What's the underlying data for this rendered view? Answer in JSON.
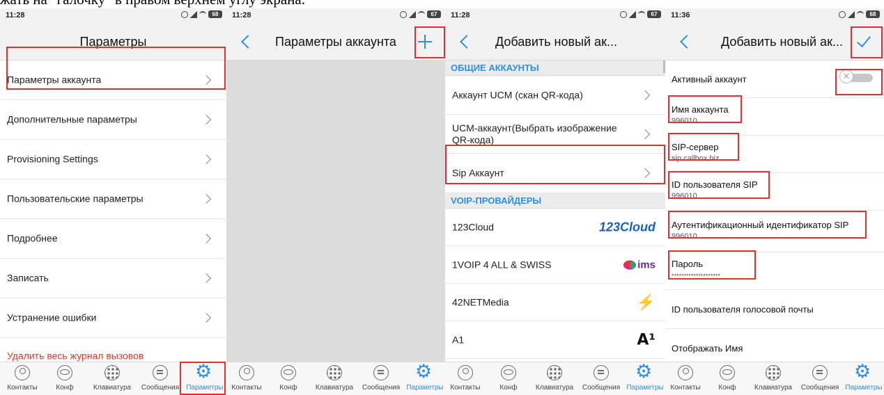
{
  "caption": "жать на \"галочку\" в правом верхнем углу экрана.",
  "status": {
    "s1": {
      "time": "11:28",
      "battery": "68"
    },
    "s2": {
      "time": "11:28",
      "battery": "67"
    },
    "s3": {
      "time": "11:28",
      "battery": "67"
    },
    "s4": {
      "time": "11:36",
      "battery": "68"
    }
  },
  "screen1": {
    "title": "Параметры",
    "items": [
      "Параметры аккаунта",
      "Дополнительные параметры",
      "Provisioning Settings",
      "Пользовательские параметры",
      "Подробнее",
      "Записать",
      "Устранение ошибки",
      "Удалить весь журнал вызовов"
    ]
  },
  "screen2": {
    "title": "Параметры аккаунта"
  },
  "screen3": {
    "title": "Добавить новый ак...",
    "section_general": "ОБЩИЕ АККАУНТЫ",
    "general_items": [
      "Аккаунт UCM (скан QR-кода)",
      "UCM-аккаунт(Выбрать изображение QR-кода)",
      "Sip Аккаунт"
    ],
    "section_voip": "VOIP-ПРОВАЙДЕРЫ",
    "providers": [
      {
        "name": "123Cloud",
        "logo": "123Cloud"
      },
      {
        "name": "1VOIP 4 ALL & SWISS",
        "logo": "ims"
      },
      {
        "name": "42NETMedia",
        "logo": "42-logo-icon"
      },
      {
        "name": "A1",
        "logo": "A1-logo-icon"
      }
    ]
  },
  "screen4": {
    "title": "Добавить новый ак...",
    "active_label": "Активный аккаунт",
    "fields": [
      {
        "label": "Имя аккаунта",
        "value": "996010"
      },
      {
        "label": "SIP-сервер",
        "value": "sip.callbox.biz"
      },
      {
        "label": "ID пользователя SIP",
        "value": "996010"
      },
      {
        "label": "Аутентификационный идентификатор SIP",
        "value": "996010"
      },
      {
        "label": "Пароль",
        "value": "********************"
      }
    ],
    "voicemail_label": "ID пользователя голосовой почты",
    "display_name_label": "Отображать Имя"
  },
  "tabs": [
    "Контакты",
    "Конф",
    "Клавиатура",
    "Сообщения",
    "Параметры"
  ],
  "colors": {
    "accent": "#2e8fe0",
    "highlight": "#e03030",
    "danger": "#d63b2d"
  }
}
